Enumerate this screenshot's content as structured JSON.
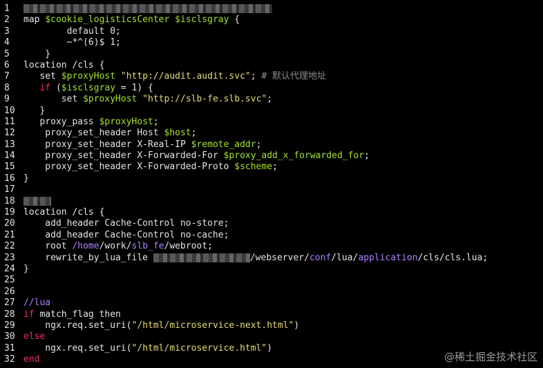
{
  "editor": {
    "lines": [
      {
        "n": "1"
      },
      {
        "n": "2",
        "parts": [
          [
            "plain",
            "map "
          ],
          [
            "var",
            "$cookie_logisticsCenter"
          ],
          [
            "plain",
            " "
          ],
          [
            "var",
            "$isclsgray"
          ],
          [
            "plain",
            " {"
          ]
        ]
      },
      {
        "n": "3",
        "parts": [
          [
            "plain",
            "        default 0;"
          ]
        ]
      },
      {
        "n": "4",
        "parts": [
          [
            "plain",
            "        ~*^(6)$ 1;"
          ]
        ]
      },
      {
        "n": "5",
        "parts": [
          [
            "plain",
            "    }"
          ]
        ]
      },
      {
        "n": "6",
        "parts": [
          [
            "plain",
            "location /cls {"
          ]
        ]
      },
      {
        "n": "7",
        "parts": [
          [
            "plain",
            "   set "
          ],
          [
            "var",
            "$proxyHost"
          ],
          [
            "plain",
            " "
          ],
          [
            "str",
            "\"http://audit.audit.svc\""
          ],
          [
            "plain",
            "; "
          ],
          [
            "cmt",
            "# 默认代理地址"
          ]
        ]
      },
      {
        "n": "8",
        "parts": [
          [
            "plain",
            "   "
          ],
          [
            "kw",
            "if"
          ],
          [
            "plain",
            " ("
          ],
          [
            "var",
            "$isclsgray"
          ],
          [
            "plain",
            " = 1) {"
          ]
        ]
      },
      {
        "n": "9",
        "parts": [
          [
            "plain",
            "       set "
          ],
          [
            "var",
            "$proxyHost"
          ],
          [
            "plain",
            " "
          ],
          [
            "str",
            "\"http://slb-fe.slb.svc\""
          ],
          [
            "plain",
            ";"
          ]
        ]
      },
      {
        "n": "10",
        "parts": [
          [
            "plain",
            "   }"
          ]
        ]
      },
      {
        "n": "11",
        "parts": [
          [
            "plain",
            "   proxy_pass "
          ],
          [
            "var",
            "$proxyHost"
          ],
          [
            "plain",
            ";"
          ]
        ]
      },
      {
        "n": "12",
        "parts": [
          [
            "plain",
            "    proxy_set_header Host "
          ],
          [
            "var",
            "$host"
          ],
          [
            "plain",
            ";"
          ]
        ]
      },
      {
        "n": "13",
        "parts": [
          [
            "plain",
            "    proxy_set_header X-Real-IP "
          ],
          [
            "var",
            "$remote_addr"
          ],
          [
            "plain",
            ";"
          ]
        ]
      },
      {
        "n": "14",
        "parts": [
          [
            "plain",
            "    proxy_set_header X-Forwarded-For "
          ],
          [
            "var",
            "$proxy_add_x_forwarded_for"
          ],
          [
            "plain",
            ";"
          ]
        ]
      },
      {
        "n": "15",
        "parts": [
          [
            "plain",
            "    proxy_set_header X-Forwarded-Proto "
          ],
          [
            "var",
            "$scheme"
          ],
          [
            "plain",
            ";"
          ]
        ]
      },
      {
        "n": "16",
        "parts": [
          [
            "plain",
            "}"
          ]
        ]
      },
      {
        "n": "17",
        "parts": []
      },
      {
        "n": "18",
        "parts": []
      },
      {
        "n": "19",
        "parts": [
          [
            "plain",
            "location /cls {"
          ]
        ]
      },
      {
        "n": "20",
        "parts": [
          [
            "plain",
            "    add_header Cache-Control no-store;"
          ]
        ]
      },
      {
        "n": "21",
        "parts": [
          [
            "plain",
            "    add_header Cache-Control no-cache;"
          ]
        ]
      },
      {
        "n": "22",
        "parts": [
          [
            "plain",
            "    root "
          ],
          [
            "path",
            "/home"
          ],
          [
            "plain",
            "/work/"
          ],
          [
            "path",
            "slb_fe"
          ],
          [
            "plain",
            "/webroot;"
          ]
        ]
      },
      {
        "n": "23",
        "parts": [
          [
            "plain",
            "    rewrite_by_lua_file "
          ],
          [
            "blur",
            ""
          ],
          [
            "plain",
            "/webserver/"
          ],
          [
            "path",
            "conf"
          ],
          [
            "plain",
            "/lua/"
          ],
          [
            "path",
            "application"
          ],
          [
            "plain",
            "/cls/cls.lua;"
          ]
        ]
      },
      {
        "n": "24",
        "parts": [
          [
            "plain",
            "}"
          ]
        ]
      },
      {
        "n": "25",
        "parts": []
      },
      {
        "n": "26",
        "parts": []
      },
      {
        "n": "27",
        "parts": [
          [
            "path",
            "//lua"
          ]
        ]
      },
      {
        "n": "28",
        "parts": [
          [
            "kw",
            "if"
          ],
          [
            "plain",
            " match_flag then"
          ]
        ]
      },
      {
        "n": "29",
        "parts": [
          [
            "plain",
            "    ngx.req.set_uri("
          ],
          [
            "str",
            "\"/html/microservice-next.html\""
          ],
          [
            "plain",
            ")"
          ]
        ]
      },
      {
        "n": "30",
        "parts": [
          [
            "kw",
            "else"
          ]
        ]
      },
      {
        "n": "31",
        "parts": [
          [
            "plain",
            "    ngx.req.set_uri("
          ],
          [
            "str",
            "\"/html/microservice.html\""
          ],
          [
            "plain",
            ")"
          ]
        ]
      },
      {
        "n": "32",
        "parts": [
          [
            "kw",
            "end"
          ]
        ]
      }
    ]
  },
  "watermark": "@稀土掘金技术社区"
}
